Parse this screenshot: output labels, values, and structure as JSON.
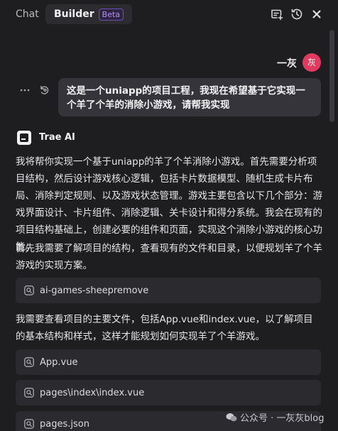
{
  "header": {
    "tabs": [
      {
        "label": "Chat"
      },
      {
        "label": "Builder",
        "badge": "Beta"
      }
    ],
    "actions": [
      "new-chat-icon",
      "history-icon",
      "close-icon"
    ]
  },
  "user": {
    "name": "一灰",
    "avatar_text": "灰",
    "avatar_color": "#e23a5e",
    "message": "这是一个uniapp的项目工程，我现在希望基于它实现一个羊了个羊的消除小游戏，请帮我实现"
  },
  "assistant": {
    "name": "Trae AI",
    "paragraphs": [
      "我将帮你实现一个基于uniapp的羊了个羊消除小游戏。首先需要分析项目结构，然后设计游戏核心逻辑，包括卡片数据模型、随机生成卡片布局、消除判定规则、以及游戏状态管理。游戏主要包含以下几个部分：游戏界面设计、卡片组件、消除逻辑、关卡设计和得分系统。我会在现有的项目结构基础上，创建必要的组件和页面，实现这个消除小游戏的核心功能。",
      "首先我需要了解项目的结构，查看现有的文件和目录，以便规划羊了个羊游戏的实现方案。",
      "我需要查看项目的主要文件，包括App.vue和index.vue，以了解项目的基本结构和样式，这样才能规划如何实现羊了个羊游戏。"
    ],
    "files": [
      {
        "label": "ai-games-sheepremove"
      },
      {
        "label": "App.vue"
      },
      {
        "label": "pages\\index\\index.vue"
      },
      {
        "label": "pages.json"
      }
    ]
  },
  "watermark": {
    "text": "公众号 · 一灰灰blog"
  },
  "colors": {
    "background": "#1e1e21",
    "bubble": "#34343a",
    "card": "#2a2a2f",
    "accent": "#b88cff"
  }
}
